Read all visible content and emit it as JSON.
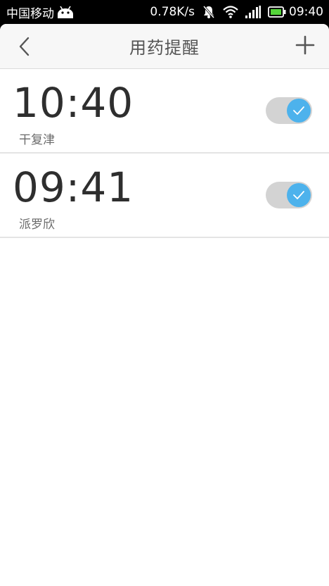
{
  "status_bar": {
    "carrier": "中国移动",
    "speed": "0.78K/s",
    "time": "09:40"
  },
  "header": {
    "title": "用药提醒"
  },
  "alarms": [
    {
      "time": "10:40",
      "name": "干复津",
      "enabled": true
    },
    {
      "time": "09:41",
      "name": "派罗欣",
      "enabled": true
    }
  ],
  "colors": {
    "accent": "#4db2ec",
    "toggle_track": "#d3d3d3",
    "header_bg": "#f7f7f7"
  }
}
